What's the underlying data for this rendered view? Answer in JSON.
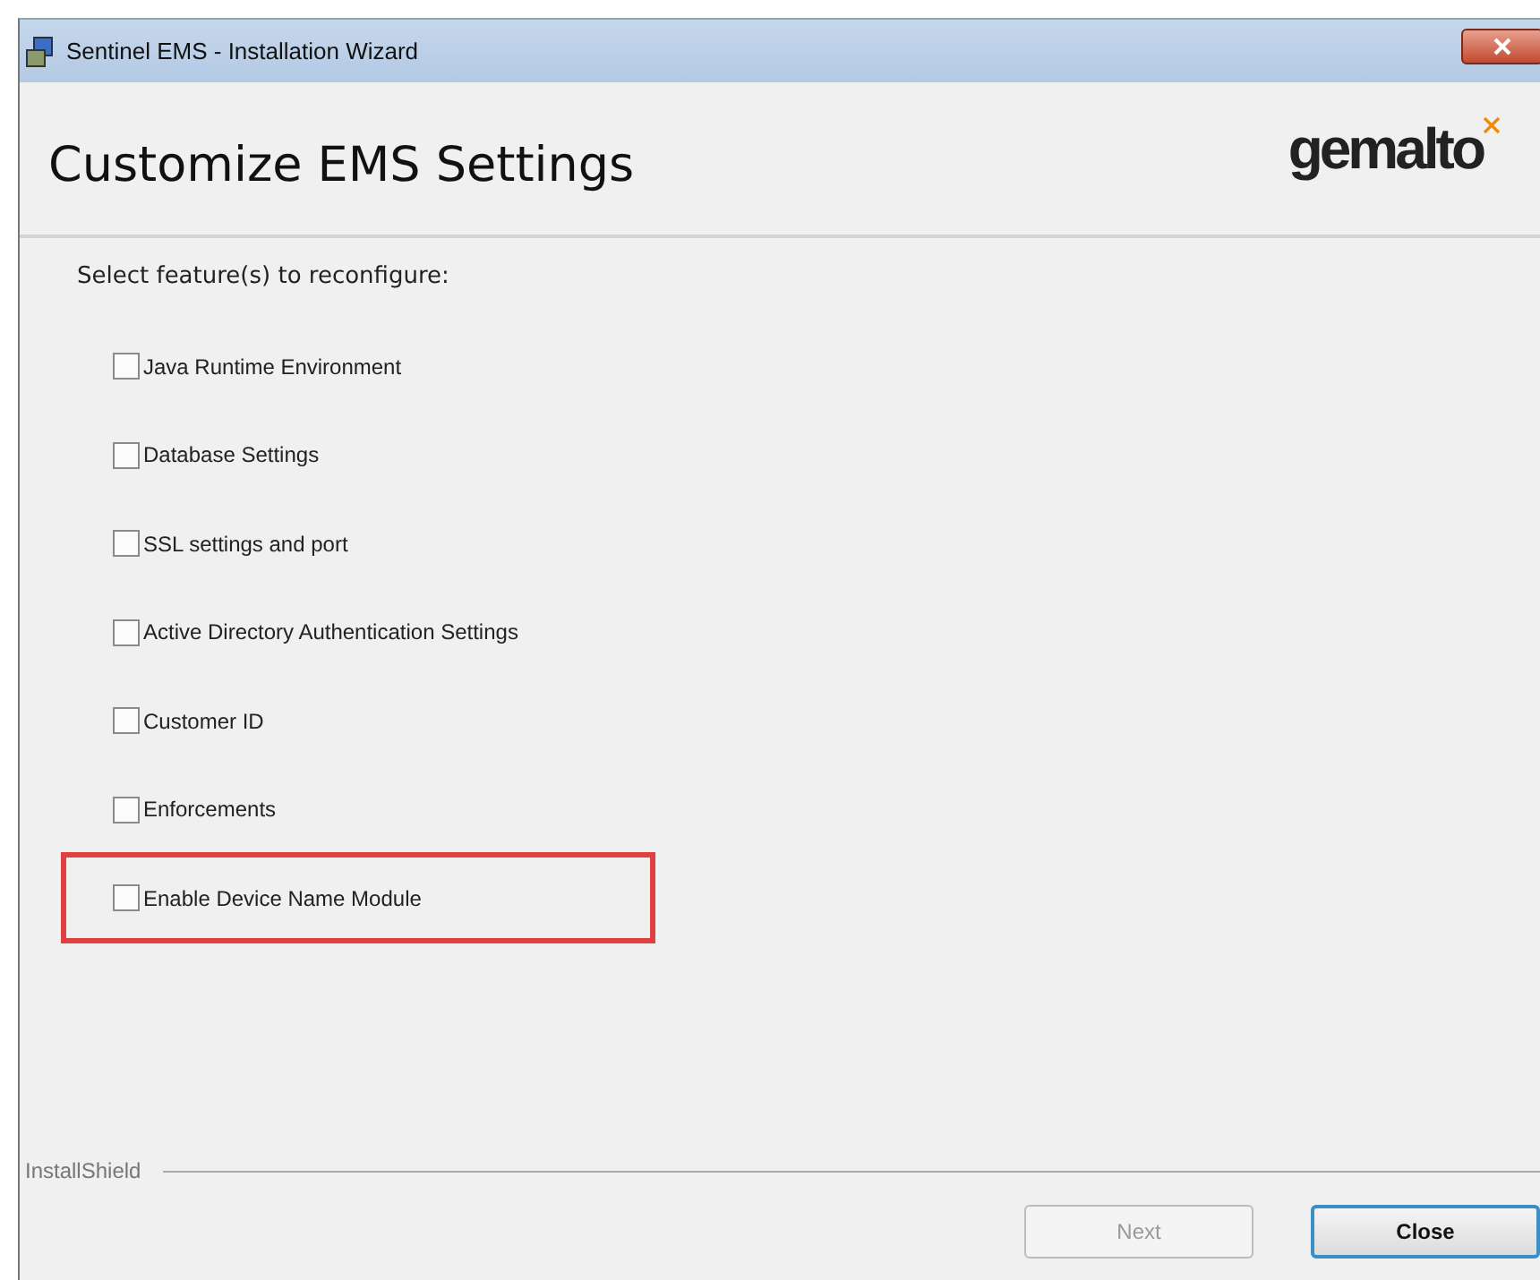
{
  "window": {
    "title": "Sentinel EMS - Installation Wizard"
  },
  "header": {
    "title": "Customize EMS Settings",
    "logo": "gemalto"
  },
  "prompt": "Select feature(s) to reconfigure:",
  "features": [
    {
      "label": "Java Runtime Environment",
      "checked": false,
      "highlighted": false
    },
    {
      "label": "Database Settings",
      "checked": false,
      "highlighted": false
    },
    {
      "label": "SSL settings and port",
      "checked": false,
      "highlighted": false
    },
    {
      "label": "Active Directory Authentication Settings",
      "checked": false,
      "highlighted": false
    },
    {
      "label": "Customer ID",
      "checked": false,
      "highlighted": false
    },
    {
      "label": "Enforcements",
      "checked": false,
      "highlighted": false
    },
    {
      "label": "Enable Device Name Module",
      "checked": false,
      "highlighted": true
    }
  ],
  "footer": {
    "brand": "InstallShield"
  },
  "buttons": [
    {
      "label": "Next",
      "disabled": true,
      "focused": false
    },
    {
      "label": "Close",
      "disabled": false,
      "focused": true
    }
  ]
}
